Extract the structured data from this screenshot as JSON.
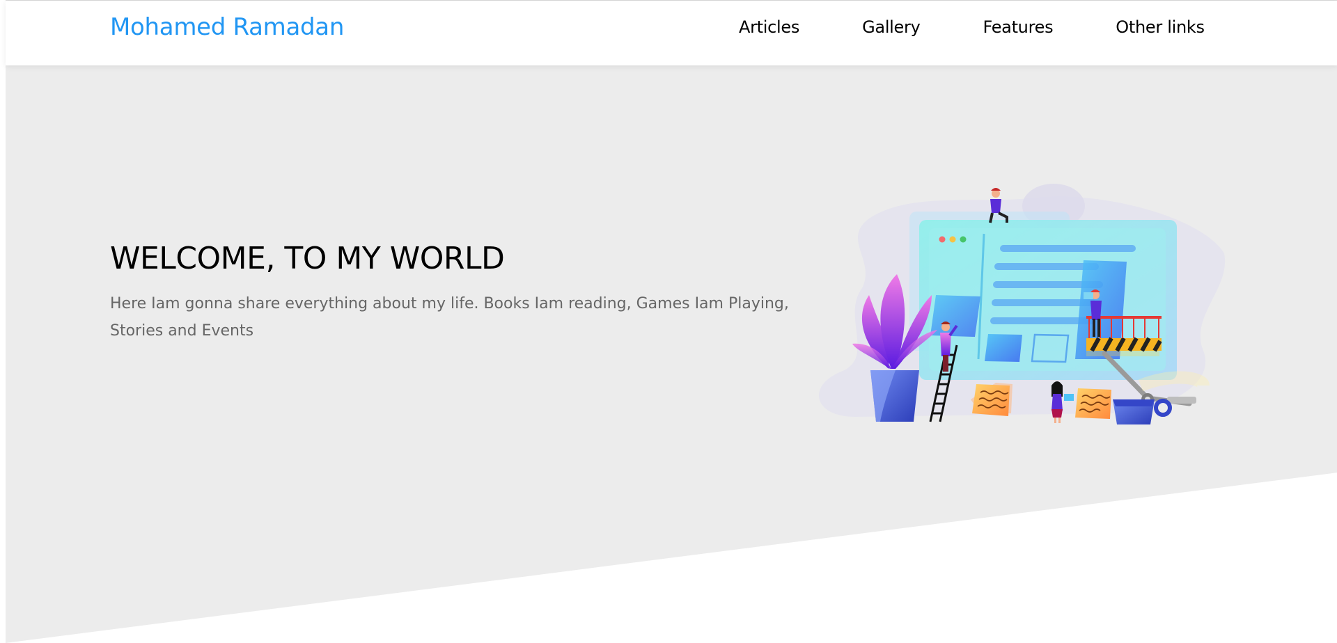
{
  "header": {
    "logo": "Mohamed Ramadan",
    "nav": [
      "Articles",
      "Gallery",
      "Features",
      "Other links"
    ]
  },
  "landing": {
    "title": "WELCOME, TO MY WORLD",
    "text": "Here Iam gonna share everything about my life. Books Iam reading, Games Iam Playing, Stories and Events"
  },
  "colors": {
    "brand": "#2196f3",
    "landing_bg": "#ececec",
    "body_text": "#666666"
  },
  "icons": [
    "hero-illustration"
  ]
}
